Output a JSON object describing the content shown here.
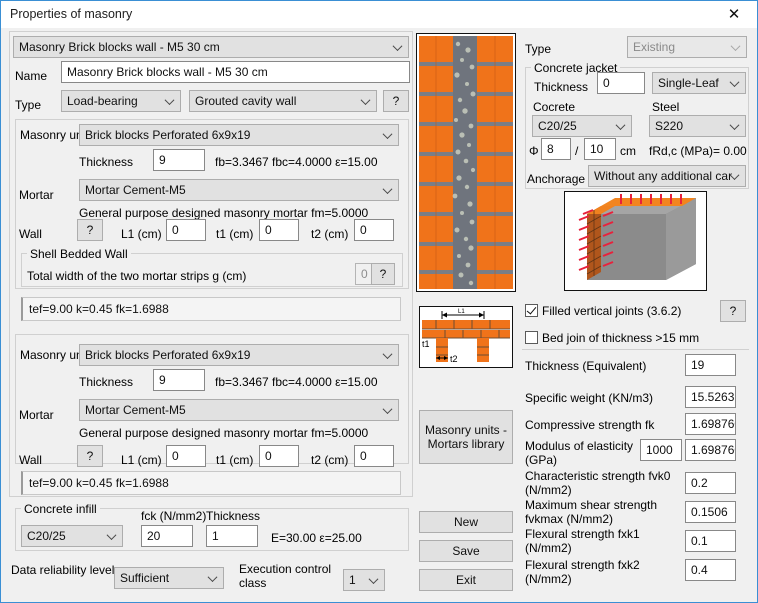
{
  "window": {
    "title": "Properties of masonry",
    "close_icon": "close-icon"
  },
  "left": {
    "preset_combo": "Masonry Brick blocks wall - M5 30 cm",
    "name_label": "Name",
    "name_value": "Masonry Brick blocks wall - M5 30 cm",
    "type_label": "Type",
    "type_value": "Load-bearing",
    "wall_type_value": "Grouted cavity wall",
    "type_help": "?",
    "leaf1": {
      "unit_label": "Masonry uni",
      "unit_value": "Brick blocks Perforated 6x9x19",
      "thickness_label": "Thickness",
      "thickness_value": "9",
      "unit_props": "fb=3.3467 fbc=4.0000 ε=15.00",
      "mortar_label": "Mortar",
      "mortar_value": "Mortar Cement-M5",
      "mortar_desc": "General purpose designed masonry mortar fm=5.0000",
      "wall_label": "Wall",
      "wall_help": "?",
      "l1_label": "L1 (cm)",
      "l1_value": "0",
      "t1_label": "t1 (cm)",
      "t1_value": "0",
      "t2_label": "t2 (cm)",
      "t2_value": "0",
      "shell_group_title": "Shell Bedded Wall",
      "shell_text": "Total width of the two mortar strips g (cm)",
      "shell_value": "0",
      "shell_help": "?",
      "result": "tef=9.00 k=0.45 fk=1.6988"
    },
    "leaf2": {
      "unit_label": "Masonry uni",
      "unit_value": "Brick blocks Perforated 6x9x19",
      "thickness_label": "Thickness",
      "thickness_value": "9",
      "unit_props": "fb=3.3467 fbc=4.0000 ε=15.00",
      "mortar_label": "Mortar",
      "mortar_value": "Mortar Cement-M5",
      "mortar_desc": "General purpose designed masonry mortar fm=5.0000",
      "wall_label": "Wall",
      "wall_help": "?",
      "l1_label": "L1 (cm)",
      "l1_value": "0",
      "t1_label": "t1 (cm)",
      "t1_value": "0",
      "t2_label": "t2 (cm)",
      "t2_value": "0",
      "result": "tef=9.00 k=0.45 fk=1.6988"
    },
    "infill": {
      "group_title": "Concrete infill",
      "class_value": "C20/25",
      "fck_label": "fck (N/mm2)",
      "fck_value": "20",
      "thickness_label": "Thickness",
      "thickness_value": "1",
      "props": "E=30.00 ε=25.00"
    },
    "footer": {
      "reliability_label": "Data reliability level",
      "reliability_value": "Sufficient",
      "execution_label": "Execution control class",
      "execution_value": "1"
    }
  },
  "center": {
    "wall_section_image": "masonry-wall-section-image",
    "detail_image": "wall-detail-diagram",
    "detail_labels": {
      "l1": "L1",
      "t1": "t1",
      "t2": "t2"
    },
    "library_button": "Masonry units - Mortars library",
    "new_button": "New",
    "save_button": "Save",
    "exit_button": "Exit"
  },
  "right": {
    "type_label": "Type",
    "type_value": "Existing",
    "jacket": {
      "group_title": "Concrete jacket",
      "thickness_label": "Thickness",
      "thickness_value": "0",
      "leaf_value": "Single-Leaf",
      "concrete_label": "Cocrete",
      "concrete_value": "C20/25",
      "steel_label": "Steel",
      "steel_value": "S220",
      "phi_label": "Φ",
      "phi_value": "8",
      "phi_sep": "/",
      "spacing_value": "10",
      "spacing_unit": "cm",
      "frd_text": "fRd,c (MPa)=  0.00",
      "anchorage_label": "Anchorage",
      "anchorage_value": "Without any additional care"
    },
    "jacket_image": "concrete-jacket-3d-image",
    "checkbox_filled_joints": {
      "label": "Filled vertical joints (3.6.2)",
      "checked": true
    },
    "checkbox_bed_join": {
      "label": "Bed join of thickness  >15 mm",
      "checked": false
    },
    "joints_help": "?",
    "properties": [
      {
        "label": "Thickness (Equivalent)",
        "value": "19"
      },
      {
        "label": "Specific weight (KN/m3)",
        "value": "15.52631"
      },
      {
        "label": "Compressive strength fk",
        "value": "1.698760"
      },
      {
        "label": "Modulus of elasticity (GPa)",
        "value": "1.698760",
        "extra_value": "1000"
      },
      {
        "label": "Characteristic strength  fvk0 (N/mm2)",
        "value": "0.2"
      },
      {
        "label": "Maximum shear strength fvkmax (N/mm2)",
        "value": "0.1506"
      },
      {
        "label": "Flexural strength  fxk1 (N/mm2)",
        "value": "0.1"
      },
      {
        "label": "Flexural strength  fxk2 (N/mm2)",
        "value": "0.4"
      }
    ]
  }
}
